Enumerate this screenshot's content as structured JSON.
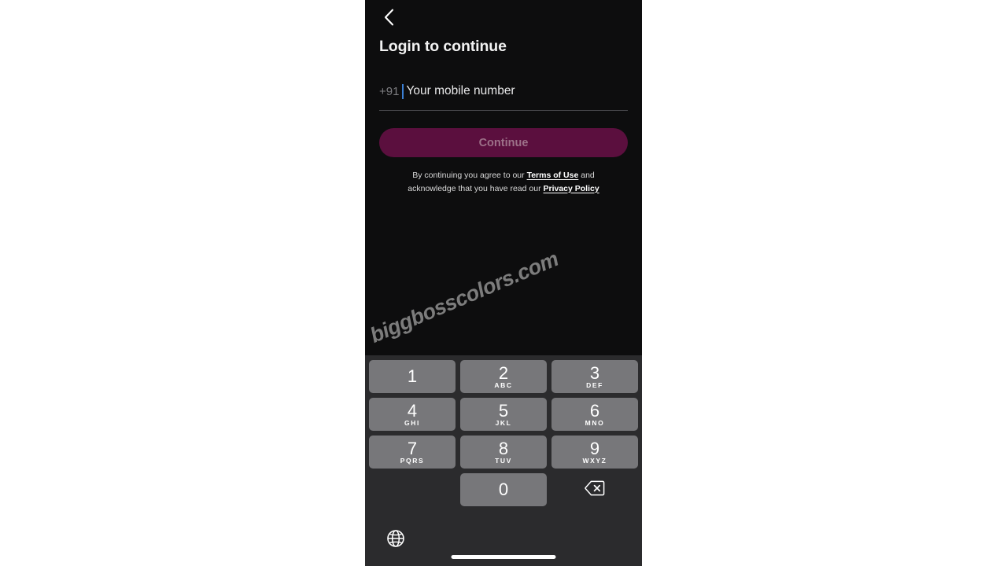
{
  "screen": {
    "background_color": "#0d0d0e",
    "page_background_color": "#ffffff"
  },
  "header": {
    "back_icon": "chevron-left-icon",
    "title": "Login to continue"
  },
  "form": {
    "country_code": "+91",
    "mobile_placeholder": "Your mobile number",
    "mobile_value": "",
    "caret_color": "#3b7fd4",
    "underline_color": "#46464a"
  },
  "cta": {
    "label": "Continue",
    "background_color": "#5b0f3e",
    "text_color": "#9d7189",
    "enabled": false
  },
  "legal": {
    "line1_prefix": "By continuing you agree to our ",
    "terms_link": "Terms of Use",
    "line1_suffix": " and",
    "line2_prefix": "acknowledge that you have read our ",
    "privacy_link": "Privacy Policy"
  },
  "watermark": {
    "text": "biggbosscolors.com"
  },
  "keyboard": {
    "background_color": "#2b2b2d",
    "key_color": "#77777a",
    "rows": [
      [
        {
          "digit": "1",
          "letters": ""
        },
        {
          "digit": "2",
          "letters": "ABC"
        },
        {
          "digit": "3",
          "letters": "DEF"
        }
      ],
      [
        {
          "digit": "4",
          "letters": "GHI"
        },
        {
          "digit": "5",
          "letters": "JKL"
        },
        {
          "digit": "6",
          "letters": "MNO"
        }
      ],
      [
        {
          "digit": "7",
          "letters": "PQRS"
        },
        {
          "digit": "8",
          "letters": "TUV"
        },
        {
          "digit": "9",
          "letters": "WXYZ"
        }
      ]
    ],
    "zero_key": {
      "digit": "0",
      "letters": ""
    },
    "backspace_icon": "backspace-delete-icon",
    "globe_icon": "globe-language-icon"
  },
  "system": {
    "home_indicator": "home-indicator-bar"
  }
}
